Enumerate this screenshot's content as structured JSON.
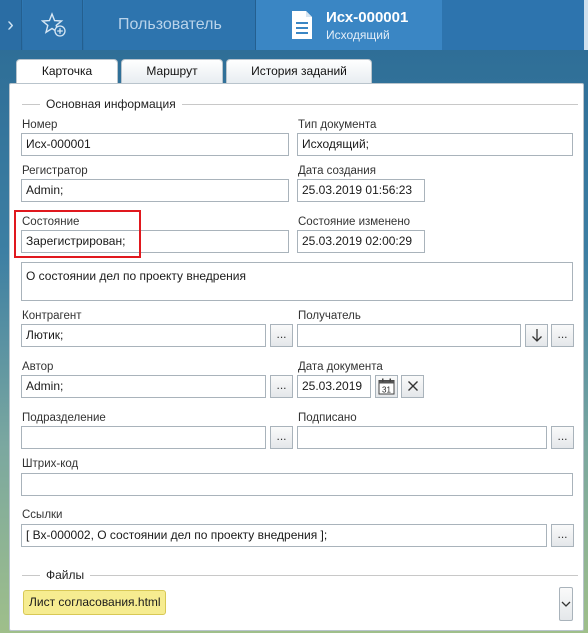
{
  "topbar": {
    "user_tab": "Пользователь",
    "doc_tab_title": "Исх-000001",
    "doc_tab_subtitle": "Исходящий"
  },
  "tabs": [
    "Карточка",
    "Маршрут",
    "История заданий"
  ],
  "section_main": "Основная информация",
  "fields": {
    "number": {
      "label": "Номер",
      "value": "Исх-000001"
    },
    "doc_type": {
      "label": "Тип документа",
      "value": "Исходящий;"
    },
    "registrar": {
      "label": "Регистратор",
      "value": "Admin;"
    },
    "created": {
      "label": "Дата создания",
      "value": "25.03.2019  01:56:23"
    },
    "state": {
      "label": "Состояние",
      "value": "Зарегистрирован;"
    },
    "state_changed": {
      "label": "Состояние изменено",
      "value": "25.03.2019  02:00:29"
    },
    "subject": {
      "value": "О состоянии дел по проекту внедрения"
    },
    "counterparty": {
      "label": "Контрагент",
      "value": "Лютик;"
    },
    "recipient": {
      "label": "Получатель",
      "value": ""
    },
    "author": {
      "label": "Автор",
      "value": "Admin;"
    },
    "doc_date": {
      "label": "Дата документа",
      "value": "25.03.2019"
    },
    "department": {
      "label": "Подразделение",
      "value": ""
    },
    "signed": {
      "label": "Подписано",
      "value": ""
    },
    "barcode": {
      "label": "Штрих-код",
      "value": ""
    },
    "links": {
      "label": "Ссылки",
      "value": "[ Вх-000002, О состоянии дел по проекту внедрения ];"
    }
  },
  "ellipsis": "...",
  "calendar_day": "31",
  "section_files": "Файлы",
  "files": [
    "Лист согласования.html"
  ],
  "icons": {
    "nav": "chevron-right-icon",
    "favorite": "star-add-icon",
    "document": "document-icon",
    "recipient_add": "arrow-down-icon",
    "calendar": "calendar-icon",
    "clear": "close-icon",
    "dropdown": "chevron-down-icon"
  }
}
